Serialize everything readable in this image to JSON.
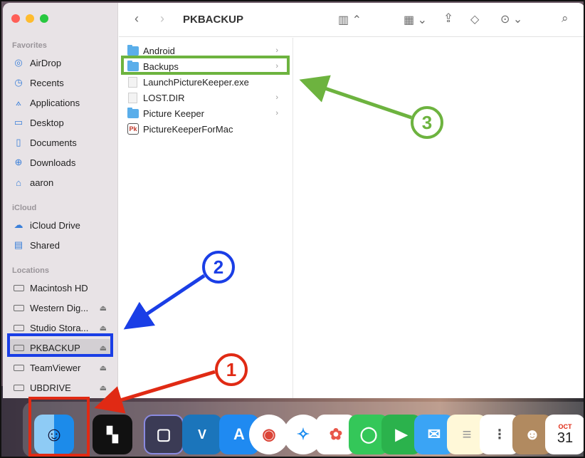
{
  "window": {
    "title": "PKBACKUP"
  },
  "sidebar": {
    "sections": {
      "favorites": "Favorites",
      "icloud": "iCloud",
      "locations": "Locations"
    },
    "favorites": [
      {
        "label": "AirDrop",
        "icon": "airdrop-icon"
      },
      {
        "label": "Recents",
        "icon": "clock-icon"
      },
      {
        "label": "Applications",
        "icon": "applications-icon"
      },
      {
        "label": "Desktop",
        "icon": "desktop-icon"
      },
      {
        "label": "Documents",
        "icon": "document-icon"
      },
      {
        "label": "Downloads",
        "icon": "download-icon"
      },
      {
        "label": "aaron",
        "icon": "home-icon"
      }
    ],
    "icloud": [
      {
        "label": "iCloud Drive",
        "icon": "cloud-icon"
      },
      {
        "label": "Shared",
        "icon": "shared-folder-icon"
      }
    ],
    "locations": [
      {
        "label": "Macintosh HD"
      },
      {
        "label": "Western Dig..."
      },
      {
        "label": "Studio Stora..."
      },
      {
        "label": "PKBACKUP"
      },
      {
        "label": "TeamViewer"
      },
      {
        "label": "UBDRIVE"
      }
    ]
  },
  "files": [
    {
      "name": "Android",
      "kind": "folder"
    },
    {
      "name": "Backups",
      "kind": "folder"
    },
    {
      "name": "LaunchPictureKeeper.exe",
      "kind": "file"
    },
    {
      "name": "LOST.DIR",
      "kind": "file-folder"
    },
    {
      "name": "Picture Keeper",
      "kind": "folder"
    },
    {
      "name": "PictureKeeperForMac",
      "kind": "app"
    }
  ],
  "app_icon_text": "Pk",
  "annotations": {
    "step1": "1",
    "step2": "2",
    "step3": "3"
  },
  "dock": {
    "calendar_month": "OCT",
    "calendar_day": "31"
  },
  "colors": {
    "step1": "#e02a14",
    "step2": "#1a3ee6",
    "step3": "#6db33f",
    "folder": "#5aaeea"
  }
}
